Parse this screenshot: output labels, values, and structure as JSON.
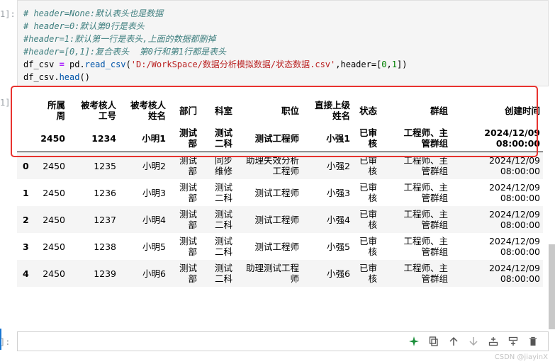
{
  "code_cell": {
    "prompt": "1]:",
    "lines": [
      {
        "type": "comment",
        "text": "# header=None:默认表头也是数据"
      },
      {
        "type": "comment",
        "text": "# header=0:默认第0行是表头"
      },
      {
        "type": "comment",
        "text": "#header=1:默认第一行是表头,上面的数据都删掉"
      },
      {
        "type": "comment",
        "text": "#header=[0,1]:复合表头  第0行和第1行都是表头"
      }
    ],
    "line5": {
      "var": "df_csv",
      "op": " = ",
      "obj": "pd.",
      "fn": "read_csv",
      "open": "(",
      "str": "'D:/WorkSpace/数据分析模拟数据/状态数据.csv'",
      "rest": ",header=[",
      "n0": "0",
      "comma": ",",
      "n1": "1",
      "close": "])"
    },
    "line6": {
      "obj": "df_csv.",
      "fn": "head",
      "rest": "()"
    }
  },
  "output": {
    "prompt": "1]",
    "header_row1": [
      "所属\n周",
      "被考核人\n工号",
      "被考核人\n姓名",
      "部门",
      "科室",
      "职位",
      "直接上级\n姓名",
      "状态",
      "群组",
      "创建时间"
    ],
    "header_row2": [
      "2450",
      "1234",
      "小明1",
      "测试\n部",
      "测试\n二科",
      "测试工程师",
      "小强1",
      "已审\n核",
      "工程师、主\n管群组",
      "2024/12/09\n08:00:00"
    ],
    "rows": [
      {
        "idx": "0",
        "cells": [
          "2450",
          "1235",
          "小明2",
          "测试\n部",
          "同步\n维修",
          "助理失效分析\n工程师",
          "小强2",
          "已审\n核",
          "工程师、主\n管群组",
          "2024/12/09\n08:00:00"
        ]
      },
      {
        "idx": "1",
        "cells": [
          "2450",
          "1236",
          "小明3",
          "测试\n部",
          "测试\n二科",
          "测试工程师",
          "小强3",
          "已审\n核",
          "工程师、主\n管群组",
          "2024/12/09\n08:00:00"
        ]
      },
      {
        "idx": "2",
        "cells": [
          "2450",
          "1237",
          "小明4",
          "测试\n部",
          "测试\n二科",
          "测试工程师",
          "小强4",
          "已审\n核",
          "工程师、主\n管群组",
          "2024/12/09\n08:00:00"
        ]
      },
      {
        "idx": "3",
        "cells": [
          "2450",
          "1238",
          "小明5",
          "测试\n部",
          "测试\n二科",
          "测试工程师",
          "小强5",
          "已审\n核",
          "工程师、主\n管群组",
          "2024/12/09\n08:00:00"
        ]
      },
      {
        "idx": "4",
        "cells": [
          "2450",
          "1239",
          "小明6",
          "测试\n部",
          "测试\n二科",
          "助理测试工程\n师",
          "小强6",
          "已审\n核",
          "工程师、主\n管群组",
          "2024/12/09\n08:00:00"
        ]
      }
    ]
  },
  "new_cell": {
    "prompt": "]:"
  },
  "toolbar": {
    "icons": [
      "sparkle-icon",
      "copy-icon",
      "move-up-icon",
      "move-down-icon",
      "insert-below-icon",
      "insert-above-icon",
      "delete-icon"
    ]
  },
  "watermark": "CSDN @jiayinX",
  "colors": {
    "highlight_box": "#e8332f",
    "comment": "#408080",
    "string": "#ba2121",
    "number": "#008000"
  }
}
